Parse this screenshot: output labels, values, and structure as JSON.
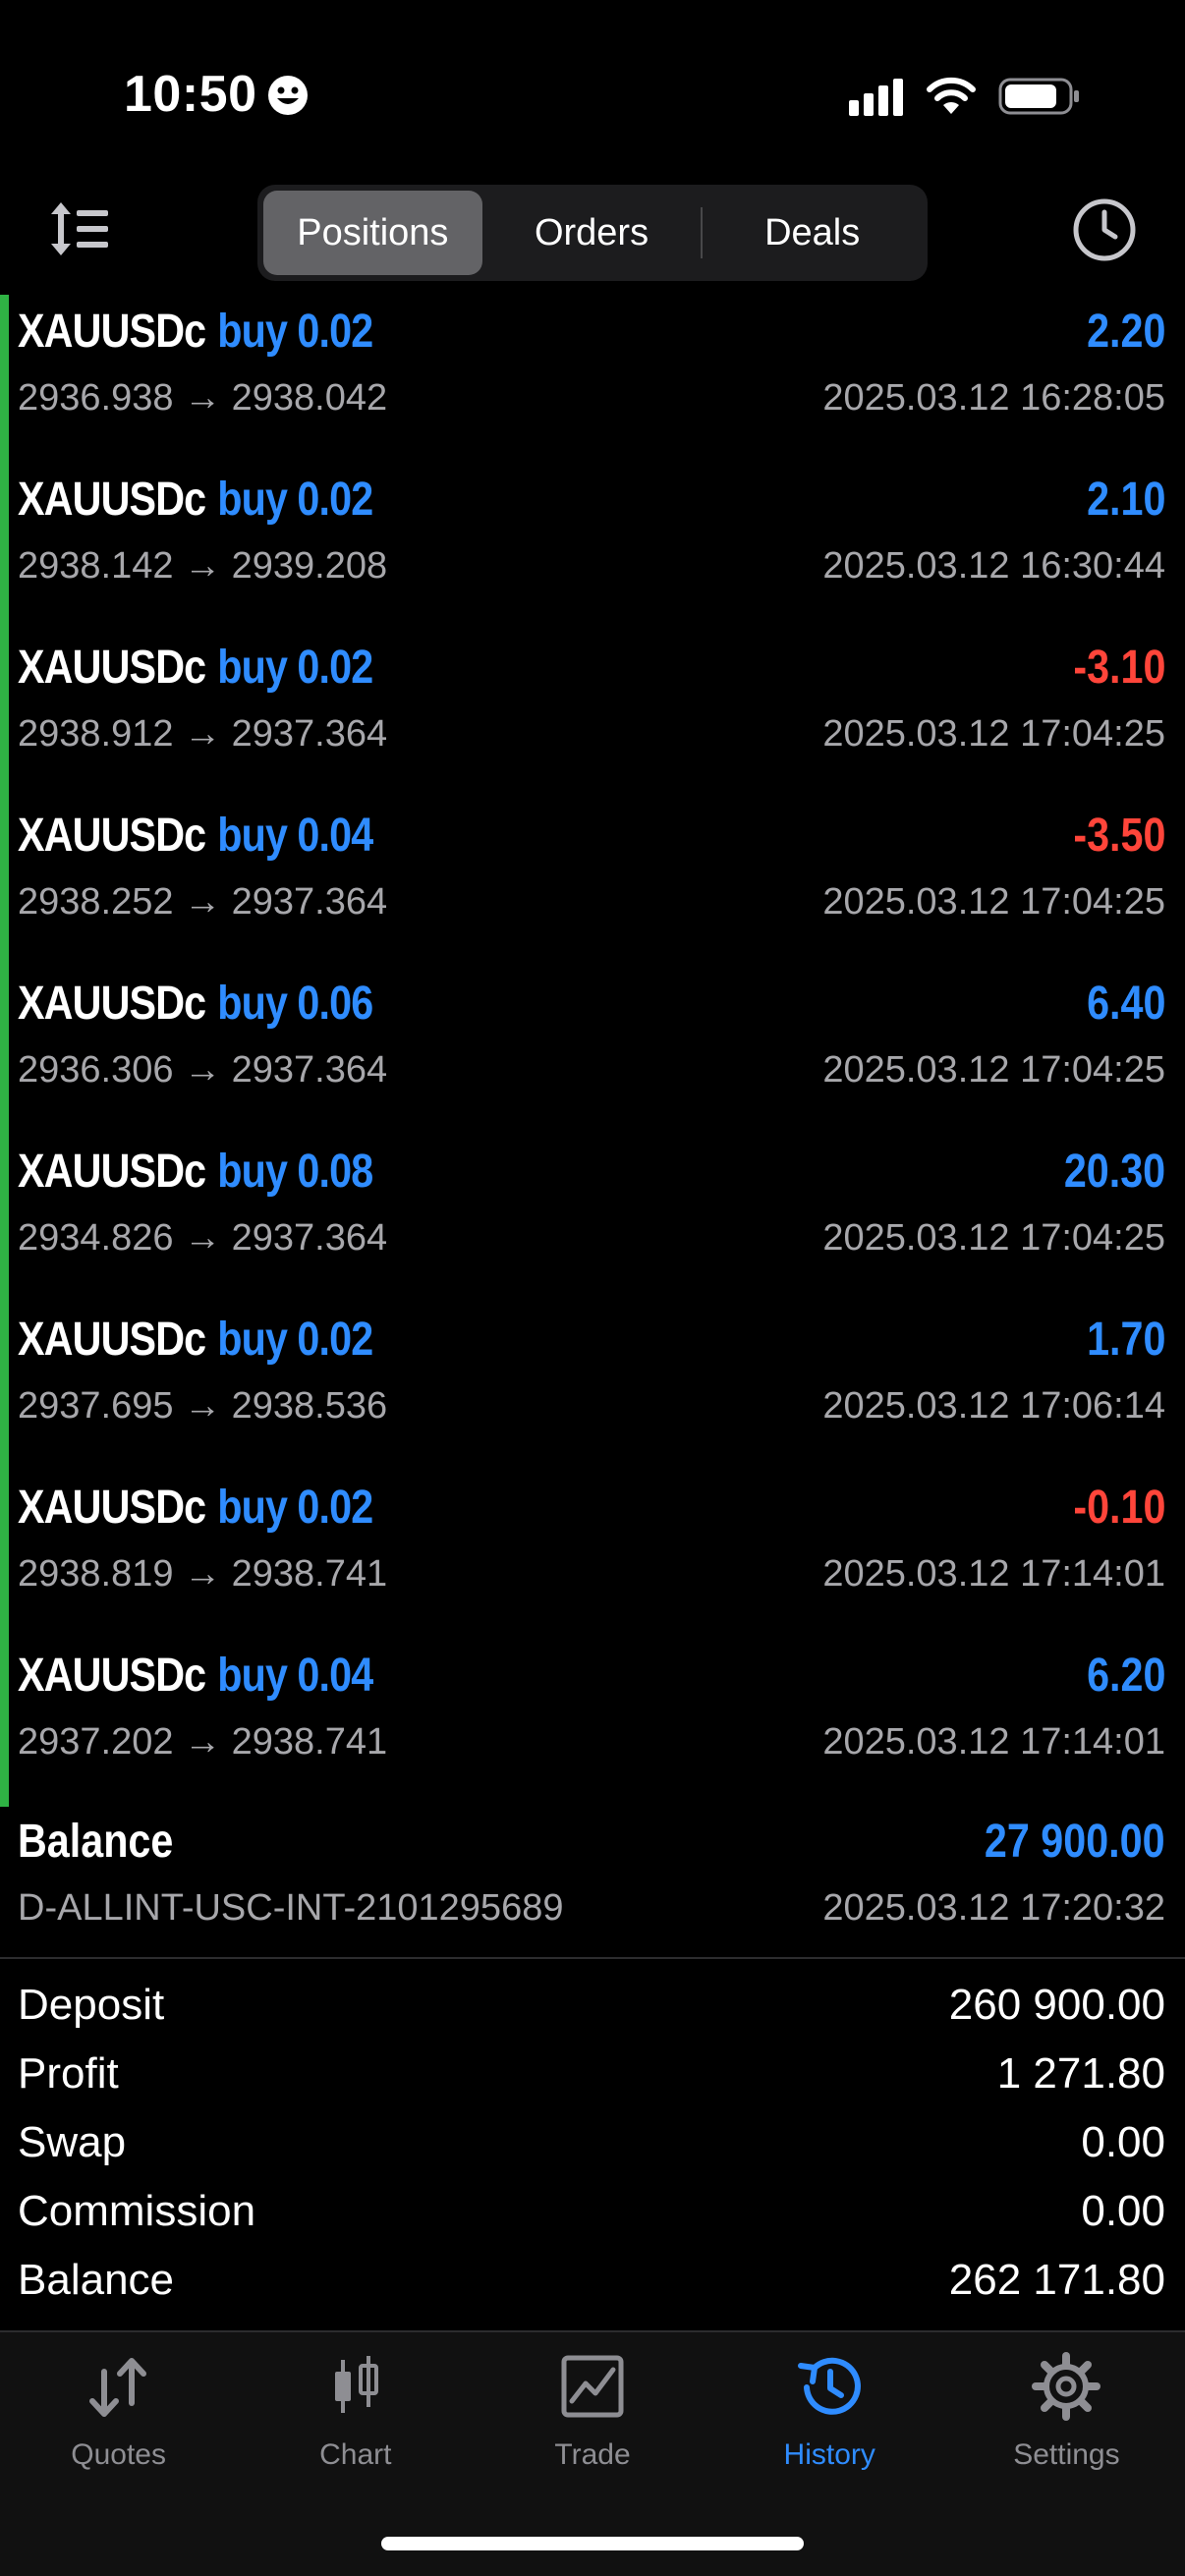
{
  "status": {
    "time": "10:50"
  },
  "segments": [
    {
      "label": "Positions",
      "active": true
    },
    {
      "label": "Orders",
      "active": false
    },
    {
      "label": "Deals",
      "active": false
    }
  ],
  "positions": [
    {
      "symbol": "XAUUSDc",
      "direction": "buy",
      "volume": "0.02",
      "profit": "2.20",
      "open": "2936.938",
      "arrow": "→",
      "close": "2938.042",
      "datetime": "2025.03.12 16:28:05"
    },
    {
      "symbol": "XAUUSDc",
      "direction": "buy",
      "volume": "0.02",
      "profit": "2.10",
      "open": "2938.142",
      "arrow": "→",
      "close": "2939.208",
      "datetime": "2025.03.12 16:30:44"
    },
    {
      "symbol": "XAUUSDc",
      "direction": "buy",
      "volume": "0.02",
      "profit": "-3.10",
      "open": "2938.912",
      "arrow": "→",
      "close": "2937.364",
      "datetime": "2025.03.12 17:04:25"
    },
    {
      "symbol": "XAUUSDc",
      "direction": "buy",
      "volume": "0.04",
      "profit": "-3.50",
      "open": "2938.252",
      "arrow": "→",
      "close": "2937.364",
      "datetime": "2025.03.12 17:04:25"
    },
    {
      "symbol": "XAUUSDc",
      "direction": "buy",
      "volume": "0.06",
      "profit": "6.40",
      "open": "2936.306",
      "arrow": "→",
      "close": "2937.364",
      "datetime": "2025.03.12 17:04:25"
    },
    {
      "symbol": "XAUUSDc",
      "direction": "buy",
      "volume": "0.08",
      "profit": "20.30",
      "open": "2934.826",
      "arrow": "→",
      "close": "2937.364",
      "datetime": "2025.03.12 17:04:25"
    },
    {
      "symbol": "XAUUSDc",
      "direction": "buy",
      "volume": "0.02",
      "profit": "1.70",
      "open": "2937.695",
      "arrow": "→",
      "close": "2938.536",
      "datetime": "2025.03.12 17:06:14"
    },
    {
      "symbol": "XAUUSDc",
      "direction": "buy",
      "volume": "0.02",
      "profit": "-0.10",
      "open": "2938.819",
      "arrow": "→",
      "close": "2938.741",
      "datetime": "2025.03.12 17:14:01"
    },
    {
      "symbol": "XAUUSDc",
      "direction": "buy",
      "volume": "0.04",
      "profit": "6.20",
      "open": "2937.202",
      "arrow": "→",
      "close": "2938.741",
      "datetime": "2025.03.12 17:14:01"
    }
  ],
  "balance_entry": {
    "title": "Balance",
    "amount": "27 900.00",
    "comment": "D-ALLINT-USC-INT-2101295689",
    "datetime": "2025.03.12 17:20:32"
  },
  "summary": [
    {
      "label": "Deposit",
      "value": "260 900.00"
    },
    {
      "label": "Profit",
      "value": "1 271.80"
    },
    {
      "label": "Swap",
      "value": "0.00"
    },
    {
      "label": "Commission",
      "value": "0.00"
    },
    {
      "label": "Balance",
      "value": "262 171.80"
    }
  ],
  "tabs": [
    {
      "label": "Quotes",
      "icon": "quotes-arrows-icon",
      "active": false
    },
    {
      "label": "Chart",
      "icon": "candlestick-icon",
      "active": false
    },
    {
      "label": "Trade",
      "icon": "trade-chart-icon",
      "active": false
    },
    {
      "label": "History",
      "icon": "history-clock-icon",
      "active": true
    },
    {
      "label": "Settings",
      "icon": "gear-icon",
      "active": false
    }
  ],
  "colors": {
    "accent": "#2f8cff",
    "loss": "#ff453a",
    "closed_marker": "#2fb344",
    "muted_text": "#a7a7ab"
  }
}
